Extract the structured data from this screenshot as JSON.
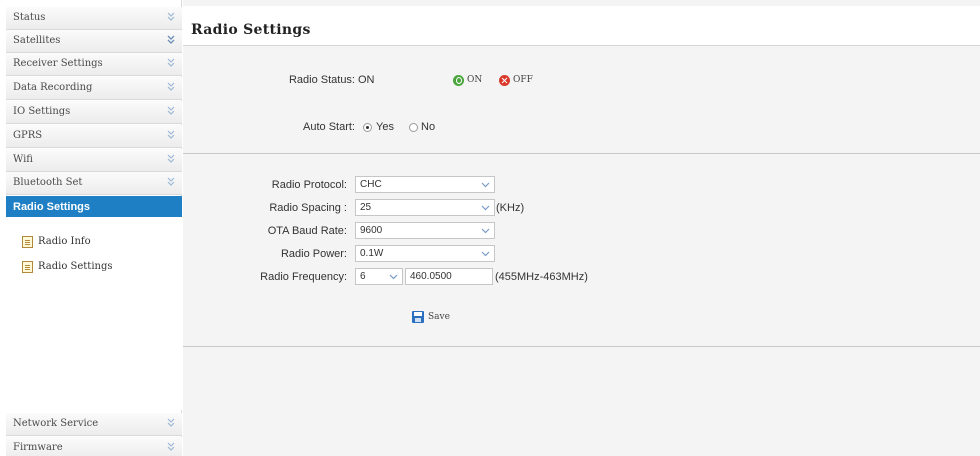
{
  "sidebar": {
    "items": [
      {
        "label": "Status"
      },
      {
        "label": "Satellites"
      },
      {
        "label": "Receiver Settings"
      },
      {
        "label": "Data Recording"
      },
      {
        "label": "IO Settings"
      },
      {
        "label": "GPRS"
      },
      {
        "label": "Wifi"
      },
      {
        "label": "Bluetooth Set"
      },
      {
        "label": "Radio Settings"
      }
    ],
    "sub_items": [
      {
        "label": "Radio Info"
      },
      {
        "label": "Radio Settings"
      }
    ],
    "bottom_items": [
      {
        "label": "Network Service"
      },
      {
        "label": "Firmware"
      }
    ],
    "active_item": "Radio Settings"
  },
  "page": {
    "title": "Radio Settings"
  },
  "status": {
    "label": "Radio Status:",
    "value": "ON",
    "on_label": "ON",
    "off_label": "OFF"
  },
  "auto_start": {
    "label": "Auto Start:",
    "yes_label": "Yes",
    "no_label": "No",
    "selected": "Yes"
  },
  "form": {
    "protocol": {
      "label": "Radio Protocol:",
      "value": "CHC"
    },
    "spacing": {
      "label": "Radio Spacing :",
      "value": "25",
      "unit": "(KHz)"
    },
    "baud": {
      "label": "OTA Baud Rate:",
      "value": "9600"
    },
    "power": {
      "label": "Radio Power:",
      "value": "0.1W"
    },
    "frequency": {
      "label": "Radio Frequency:",
      "channel": "6",
      "value": "460.0500",
      "range": "(455MHz-463MHz)"
    }
  },
  "save_label": "Save",
  "colors": {
    "accent": "#1f7fc4",
    "on_icon": "#4aa53c",
    "off_icon": "#d9382a"
  }
}
